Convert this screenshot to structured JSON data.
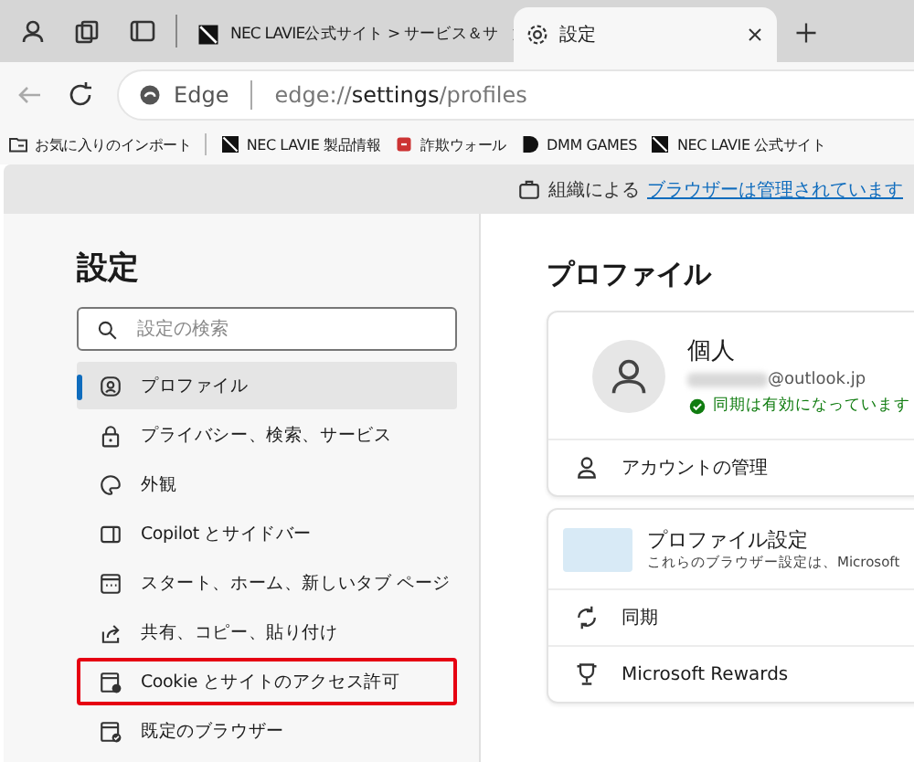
{
  "tabs": [
    {
      "label": "NEC LAVIE公式サイト > サービス＆サ",
      "selected": false,
      "kind": "site"
    },
    {
      "label": "設定",
      "selected": true,
      "kind": "settings"
    }
  ],
  "address_bar": {
    "site_label": "Edge",
    "url": "edge://**settings**/profiles"
  },
  "favorites_bar": [
    {
      "label": "お気に入りのインポート",
      "kind": "import"
    },
    {
      "label": "NEC LAVIE 製品情報",
      "kind": "site"
    },
    {
      "label": "詐欺ウォール",
      "kind": "shield"
    },
    {
      "label": "DMM GAMES",
      "kind": "dmm"
    },
    {
      "label": "NEC LAVIE 公式サイト",
      "kind": "site"
    }
  ],
  "managed_notice": {
    "text": "組織による",
    "link": "ブラウザーは管理されています"
  },
  "sidebar": {
    "title": "設定",
    "search": {
      "placeholder": "設定の検索"
    },
    "items": [
      {
        "label": "プロファイル",
        "selected": true,
        "highlighted": false
      },
      {
        "label": "プライバシー、検索、サービス",
        "selected": false,
        "highlighted": false
      },
      {
        "label": "外観",
        "selected": false,
        "highlighted": false
      },
      {
        "label": "Copilot とサイドバー",
        "selected": false,
        "highlighted": false
      },
      {
        "label": "スタート、ホーム、新しいタブ ページ",
        "selected": false,
        "highlighted": false
      },
      {
        "label": "共有、コピー、貼り付け",
        "selected": false,
        "highlighted": false
      },
      {
        "label": "Cookie とサイトのアクセス許可",
        "selected": false,
        "highlighted": true
      },
      {
        "label": "既定のブラウザー",
        "selected": false,
        "highlighted": false
      }
    ]
  },
  "content": {
    "title": "プロファイル",
    "profile": {
      "name": "個人",
      "email": "@outlook.jp",
      "sync_status": "同期は有効になっています"
    },
    "account_row": "アカウントの管理",
    "profile_settings": {
      "title": "プロファイル設定",
      "description": "これらのブラウザー設定は、Microsoft"
    },
    "rows": [
      "同期",
      "Microsoft Rewards"
    ]
  }
}
